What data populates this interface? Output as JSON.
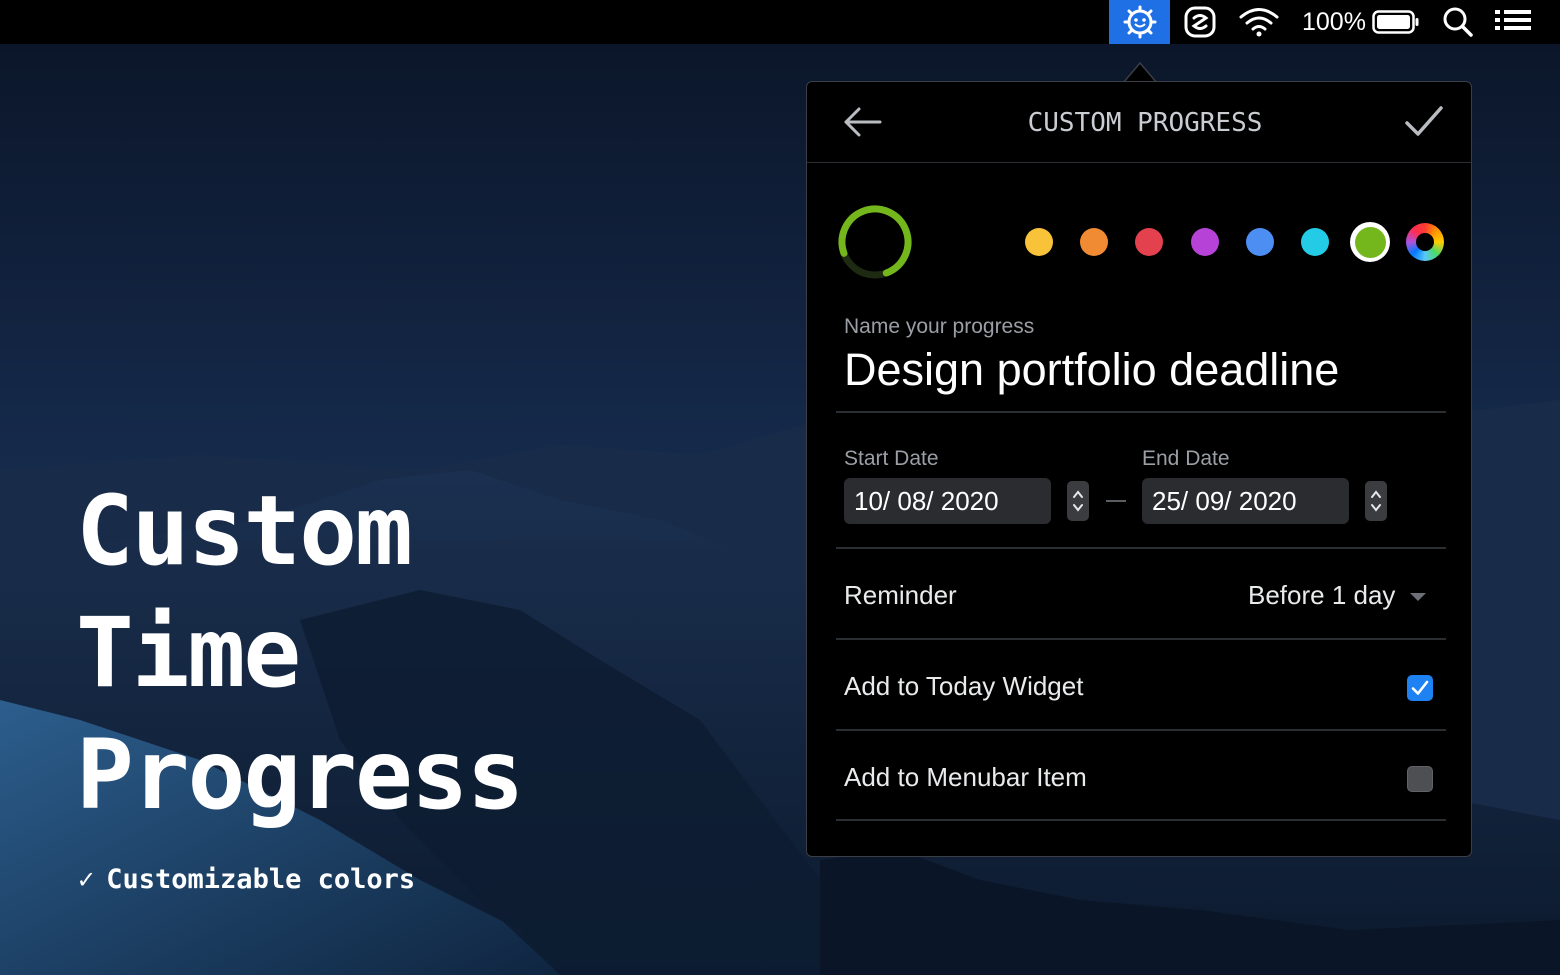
{
  "menubar": {
    "active_icon": "progress-app-icon",
    "items": [
      "progress-app-icon",
      "scripting-app-icon",
      "wifi-icon",
      "battery-icon",
      "spotlight-search-icon",
      "control-list-icon"
    ],
    "battery_percent": "100%"
  },
  "marketing": {
    "headline_lines": [
      "Custom",
      "Time",
      "Progress"
    ],
    "feature_check": "✓",
    "feature_text": "Customizable colors"
  },
  "popover": {
    "title": "CUSTOM PROGRESS",
    "progress_ring_color": "#74b71c",
    "colors": [
      {
        "name": "yellow",
        "hex": "#f8c338",
        "selected": false
      },
      {
        "name": "orange",
        "hex": "#f08a33",
        "selected": false
      },
      {
        "name": "red",
        "hex": "#e2414d",
        "selected": false
      },
      {
        "name": "purple",
        "hex": "#b742d8",
        "selected": false
      },
      {
        "name": "blue",
        "hex": "#4c8ef2",
        "selected": false
      },
      {
        "name": "cyan",
        "hex": "#24cbe7",
        "selected": false
      },
      {
        "name": "green",
        "hex": "#74b71c",
        "selected": true
      },
      {
        "name": "custom",
        "hex": "color-wheel",
        "selected": false
      }
    ],
    "name_label": "Name your progress",
    "name_value": "Design portfolio deadline",
    "start_label": "Start Date",
    "start_value": "10/ 08/ 2020",
    "end_label": "End Date",
    "end_value": "25/ 09/ 2020",
    "reminder_label": "Reminder",
    "reminder_value": "Before 1 day",
    "today_widget_label": "Add to Today Widget",
    "today_widget_checked": true,
    "menubar_item_label": "Add to Menubar Item",
    "menubar_item_checked": false
  }
}
